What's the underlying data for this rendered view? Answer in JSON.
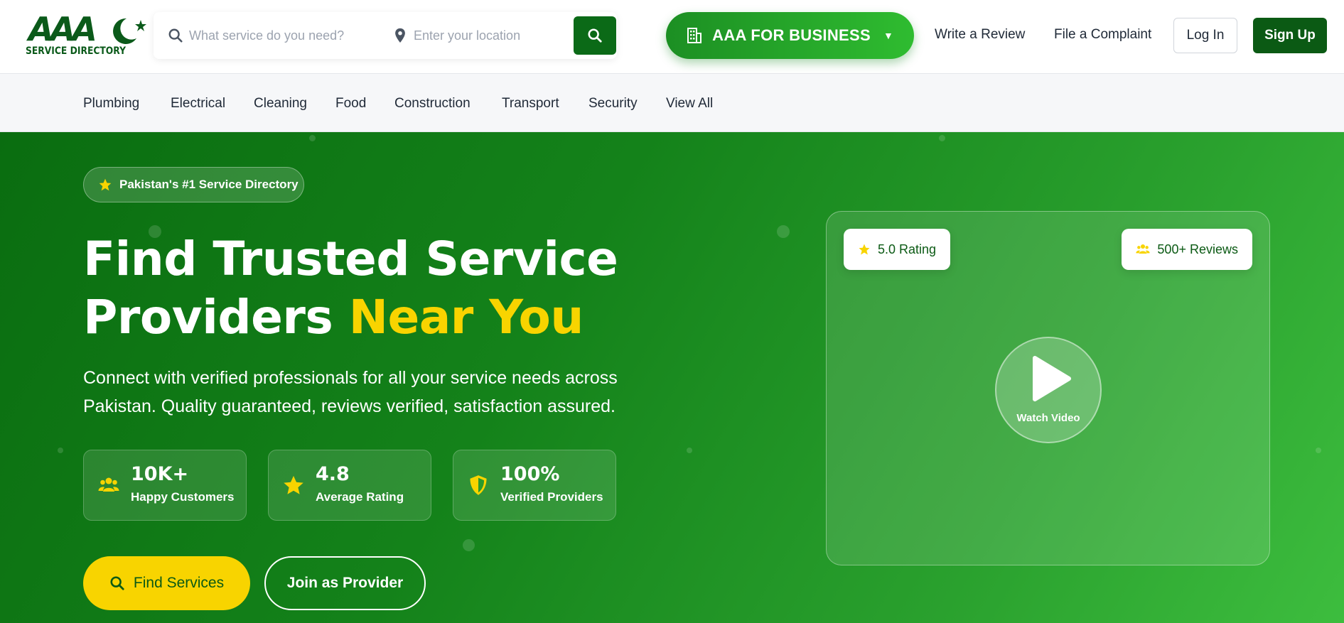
{
  "header": {
    "logo": {
      "mark": "AAA",
      "text": "SERVICE DIRECTORY"
    },
    "search": {
      "service_placeholder": "What service do you need?",
      "location_placeholder": "Enter your location"
    },
    "business_button": "AAA FOR BUSINESS",
    "links": {
      "write_review": "Write a Review",
      "file_complaint": "File a Complaint"
    },
    "login": "Log In",
    "signup": "Sign Up"
  },
  "categories": [
    "Plumbing",
    "Electrical",
    "Cleaning",
    "Food",
    "Construction",
    "Transport",
    "Security",
    "View All"
  ],
  "hero": {
    "badge": "Pakistan's #1 Service Directory",
    "title_line1": "Find Trusted Service",
    "title_line2_plain": "Providers ",
    "title_line2_highlight": "Near You",
    "lead": "Connect with verified professionals for all your service needs across Pakistan. Quality guaranteed, reviews verified, satisfaction assured.",
    "stats": [
      {
        "number": "10K+",
        "label": "Happy Customers",
        "icon": "users-icon"
      },
      {
        "number": "4.8",
        "label": "Average Rating",
        "icon": "star-icon"
      },
      {
        "number": "100%",
        "label": "Verified Providers",
        "icon": "shield-icon"
      }
    ],
    "find_button": "Find Services",
    "join_button": "Join as Provider",
    "video": {
      "rating_pill": "5.0 Rating",
      "reviews_pill": "500+ Reviews",
      "watch_label": "Watch Video"
    }
  },
  "colors": {
    "brand_dark": "#0b5a14",
    "brand": "#1c8f23",
    "accent_yellow": "#f8d400"
  }
}
